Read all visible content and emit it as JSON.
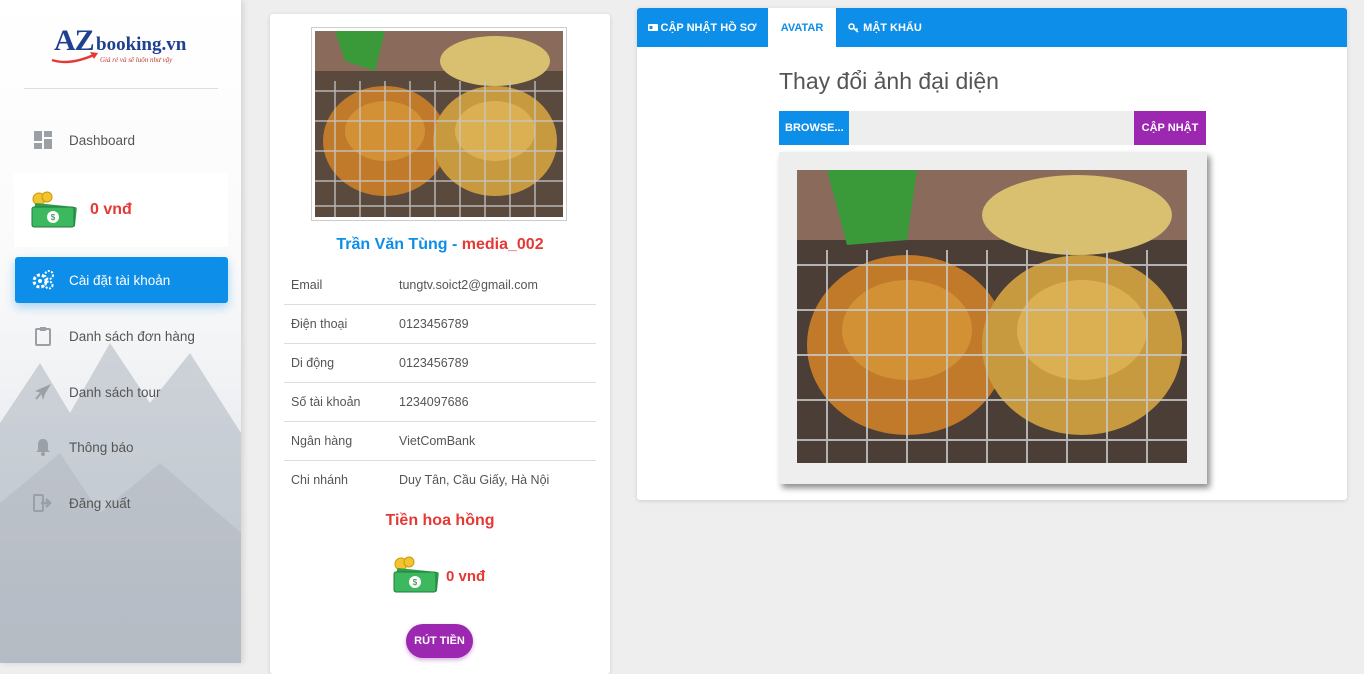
{
  "sidebar": {
    "logo": {
      "az": "AZ",
      "booking": "booking.vn",
      "tagline": "Giá rẻ và sẽ luôn như vậy"
    },
    "dashboard_label": "Dashboard",
    "balance": "0 vnđ",
    "items": [
      {
        "label": "Cài đặt tài khoản",
        "icon": "gears-icon"
      },
      {
        "label": "Danh sách đơn hàng",
        "icon": "clipboard-icon"
      },
      {
        "label": "Danh sách tour",
        "icon": "airplane-icon"
      },
      {
        "label": "Thông báo",
        "icon": "bell-icon"
      },
      {
        "label": "Đăng xuất",
        "icon": "logout-icon"
      }
    ]
  },
  "profile": {
    "name": "Trần Văn Tùng",
    "separator": " - ",
    "username": "media_002",
    "fields": [
      {
        "key": "Email",
        "value": "tungtv.soict2@gmail.com"
      },
      {
        "key": "Điện thoại",
        "value": "0123456789"
      },
      {
        "key": "Di động",
        "value": "0123456789"
      },
      {
        "key": "Số tài khoản",
        "value": "1234097686"
      },
      {
        "key": "Ngân hàng",
        "value": "VietComBank"
      },
      {
        "key": "Chi nhánh",
        "value": "Duy Tân, Cầu Giấy, Hà Nội"
      }
    ],
    "commission_title": "Tiền hoa hồng",
    "commission_amount": "0 vnđ",
    "withdraw_label": "RÚT TIỀN"
  },
  "tabs": [
    {
      "label": "CẬP NHẬT HỒ SƠ",
      "icon": "id-card-icon",
      "active": false
    },
    {
      "label": "AVATAR",
      "active": true
    },
    {
      "label": "MẬT KHẨU",
      "icon": "key-icon",
      "active": false
    }
  ],
  "avatar_section": {
    "title": "Thay đổi ảnh đại diện",
    "browse_label": "BROWSE...",
    "update_label": "CẬP NHẬT"
  },
  "colors": {
    "primary": "#0d8ee8",
    "purple": "#9c27b0",
    "red": "#e53935"
  }
}
